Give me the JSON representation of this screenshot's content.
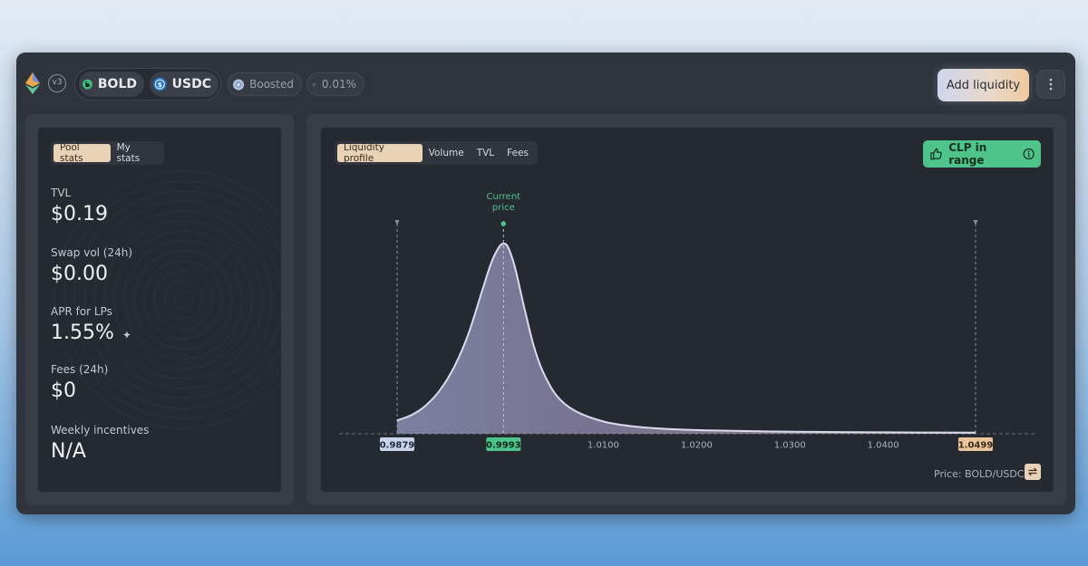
{
  "header": {
    "version_badge": "v3",
    "tokens": [
      {
        "symbol": "BOLD",
        "icon": "bold-token-icon",
        "color": "#3fbf7f"
      },
      {
        "symbol": "USDC",
        "icon": "usdc-token-icon",
        "color": "#2775ca"
      }
    ],
    "boosted_label": "Boosted",
    "fee_tier": "0.01%",
    "add_liquidity_label": "Add liquidity",
    "more_icon": "more-vertical-icon"
  },
  "left_panel": {
    "tabs": [
      {
        "label": "Pool stats",
        "active": true
      },
      {
        "label": "My stats",
        "active": false
      }
    ],
    "stats": [
      {
        "label": "TVL",
        "value": "$0.19"
      },
      {
        "label": "Swap vol (24h)",
        "value": "$0.00"
      },
      {
        "label": "APR for LPs",
        "value": "1.55%"
      },
      {
        "label": "Fees (24h)",
        "value": "$0"
      },
      {
        "label": "Weekly incentives",
        "value": "N/A"
      }
    ]
  },
  "right_panel": {
    "tabs": [
      {
        "label": "Liquidity profile",
        "active": true
      },
      {
        "label": "Volume",
        "active": false
      },
      {
        "label": "TVL",
        "active": false
      },
      {
        "label": "Fees",
        "active": false
      }
    ],
    "clp_badge": "CLP in range",
    "price_label": "Price: BOLD/USDC"
  },
  "chart_data": {
    "type": "area",
    "xlim": [
      0.9879,
      1.0499
    ],
    "x_ticks": [
      "0.9879",
      "0.9993",
      "1.0100",
      "1.0200",
      "1.0300",
      "1.0400",
      "1.0499"
    ],
    "range_min": {
      "value": 0.9879,
      "label": "0.9879"
    },
    "current_price": {
      "value": 0.9993,
      "label": "0.9993",
      "annotation_line1": "Current",
      "annotation_line2": "price"
    },
    "range_max": {
      "value": 1.0499,
      "label": "1.0499"
    },
    "series": [
      {
        "x": [
          0.9879,
          0.9895,
          0.991,
          0.9925,
          0.994,
          0.9955,
          0.997,
          0.998,
          0.9988,
          0.9993,
          0.9998,
          1.0005,
          1.0015,
          1.0025,
          1.0035,
          1.005,
          1.007,
          1.01,
          1.013,
          1.017,
          1.022,
          1.028,
          1.035,
          1.042,
          1.0499
        ],
        "y": [
          0.07,
          0.1,
          0.15,
          0.23,
          0.35,
          0.52,
          0.75,
          0.9,
          0.98,
          1.0,
          0.98,
          0.88,
          0.67,
          0.47,
          0.33,
          0.2,
          0.12,
          0.065,
          0.04,
          0.025,
          0.017,
          0.012,
          0.009,
          0.007,
          0.006
        ]
      }
    ],
    "colors": {
      "fill": "#8f8aab",
      "stroke": "#dcdaf0",
      "current": "#4ec38a",
      "max": "#e9c59c",
      "min": "#c9d3ec"
    }
  }
}
